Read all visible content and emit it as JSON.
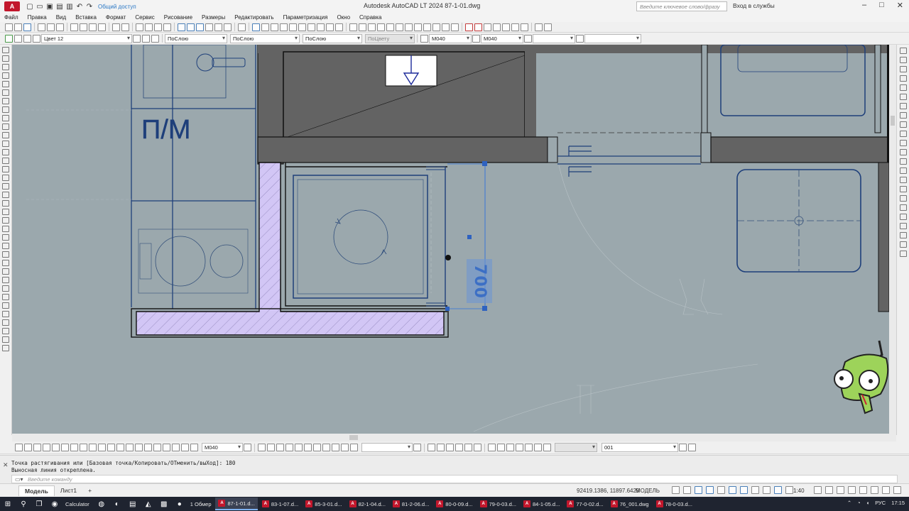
{
  "titlebar": {
    "app_logo": "A",
    "app_logo_badge": "LT",
    "share_label": "Общий доступ",
    "window_title": "Autodesk AutoCAD LT 2024    87-1-01.dwg",
    "search_placeholder": "Введите ключевое слово/фразу",
    "signin_label": "Вход в службы",
    "help_icon": "?"
  },
  "menu": [
    "Файл",
    "Правка",
    "Вид",
    "Вставка",
    "Формат",
    "Сервис",
    "Рисование",
    "Размеры",
    "Редактировать",
    "Параметризация",
    "Окно",
    "Справка"
  ],
  "properties": {
    "layer": "Цвет 12",
    "color": "ПоСлою",
    "linetype": "ПоСлою",
    "lineweight": "ПоСлою",
    "plotstyle": "ПоЦвету",
    "dimstyle": "M040",
    "dimstyle2": "M040"
  },
  "drawing": {
    "room_label": "П/М",
    "dimension_value": "700",
    "colors": {
      "background": "#9ba8ad",
      "wall_fill": "#636363",
      "hatch_fill": "#d2c6f5",
      "line_blue": "#1e3f7a",
      "selection": "#3c6fc5"
    }
  },
  "bottom_toolbar": {
    "dimstyle": "M040",
    "layer_filter": "001"
  },
  "command": {
    "history_line1": "Точка растягивания или [Базовая точка/Копировать/ОТменить/выХод]: 180",
    "history_line2": "Выносная линия открeплена.",
    "input_placeholder": "Введите команду"
  },
  "status": {
    "tab_model": "Модель",
    "tab_sheet": "Лист1",
    "add_tab": "+",
    "coordinates": "92419.1386, 11897.6429",
    "space": "МОДЕЛЬ",
    "scale": "1:40"
  },
  "taskbar": {
    "apps": [
      {
        "label": "Calculator",
        "active": false
      },
      {
        "label": "1 Обмер",
        "active": false
      },
      {
        "label": "87-1-01.d...",
        "active": true
      },
      {
        "label": "83-1-07.d...",
        "active": false
      },
      {
        "label": "85-3-01.d...",
        "active": false
      },
      {
        "label": "82-1-04.d...",
        "active": false
      },
      {
        "label": "81-2-06.d...",
        "active": false
      },
      {
        "label": "80-0-09.d...",
        "active": false
      },
      {
        "label": "79-0-03.d...",
        "active": false
      },
      {
        "label": "84-1-05.d...",
        "active": false
      },
      {
        "label": "77-0-02.d...",
        "active": false
      },
      {
        "label": "76_001.dwg",
        "active": false
      },
      {
        "label": "78-0-03.d...",
        "active": false
      }
    ],
    "language": "РУС",
    "time": "17:15"
  }
}
